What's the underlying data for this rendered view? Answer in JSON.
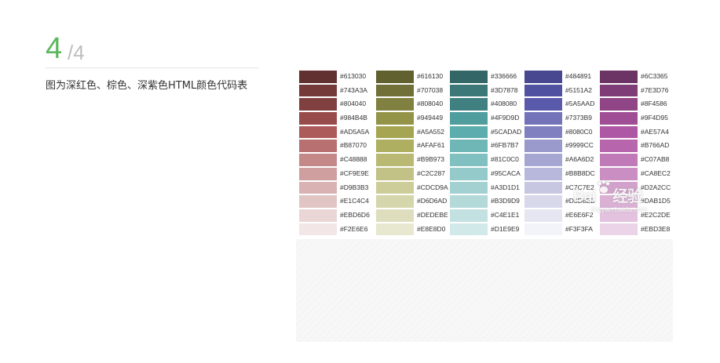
{
  "step": {
    "current": "4",
    "total": "/4"
  },
  "description": "图为深红色、棕色、深紫色HTML颜色代码表",
  "watermark": {
    "brand": "Bai",
    "brand_cn": "经验",
    "url": "jingyan.baidu.com"
  },
  "colors": {
    "dark_red": [
      "#613030",
      "#743A3A",
      "#804040",
      "#984B4B",
      "#AD5A5A",
      "#B87070",
      "#C48888",
      "#CF9E9E",
      "#D9B3B3",
      "#E1C4C4",
      "#EBD6D6",
      "#F2E6E6"
    ],
    "olive": [
      "#616130",
      "#707038",
      "#808040",
      "#949449",
      "#A5A552",
      "#AFAF61",
      "#B9B973",
      "#C2C287",
      "#CDCD9A",
      "#D6D6AD",
      "#DEDEBE",
      "#E8E8D0"
    ],
    "teal": [
      "#336666",
      "#3D7878",
      "#408080",
      "#4F9D9D",
      "#5CADAD",
      "#6FB7B7",
      "#81C0C0",
      "#95CACA",
      "#A3D1D1",
      "#B3D9D9",
      "#C4E1E1",
      "#D1E9E9"
    ],
    "indigo": [
      "#484891",
      "#5151A2",
      "#5A5AAD",
      "#7373B9",
      "#8080C0",
      "#9999CC",
      "#A6A6D2",
      "#B8B8DC",
      "#C7C7E2",
      "#D8D8EB",
      "#E6E6F2",
      "#F3F3FA"
    ],
    "purple": [
      "#6C3365",
      "#7E3D76",
      "#8F4586",
      "#9F4D95",
      "#AE57A4",
      "#B766AD",
      "#C07AB8",
      "#CA8EC2",
      "#D2A2CC",
      "#DAB1D5",
      "#E2C2DE",
      "#EBD3E8"
    ]
  }
}
